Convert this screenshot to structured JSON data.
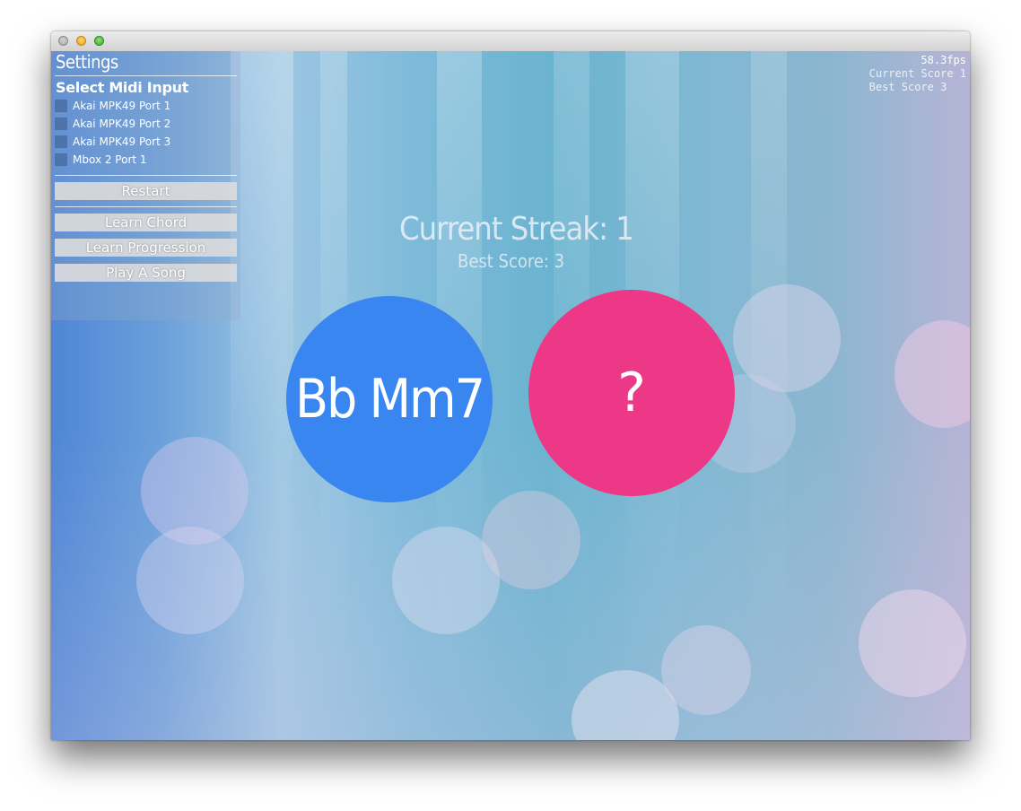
{
  "window": {
    "traffic_lights": [
      "close",
      "minimize",
      "maximize"
    ]
  },
  "settings": {
    "title": "Settings",
    "midi_section": "Select Midi Input",
    "ports": [
      {
        "label": "Akai MPK49 Port 1"
      },
      {
        "label": "Akai MPK49 Port 2"
      },
      {
        "label": "Akai MPK49 Port 3"
      },
      {
        "label": "Mbox 2 Port 1"
      }
    ],
    "restart_label": "Restart",
    "modes": [
      {
        "label": "Learn Chord"
      },
      {
        "label": "Learn Progression"
      },
      {
        "label": "Play A Song"
      }
    ]
  },
  "stats": {
    "fps": "58.3fps",
    "current_score": "Current Score 1",
    "best_score": "Best Score 3"
  },
  "game": {
    "streak_title": "Current Streak: 1",
    "best_score": "Best Score: 3",
    "chord": "Bb Mm7",
    "answer": "?",
    "chord_color": "#3a86f0",
    "answer_color": "#ec3886"
  }
}
